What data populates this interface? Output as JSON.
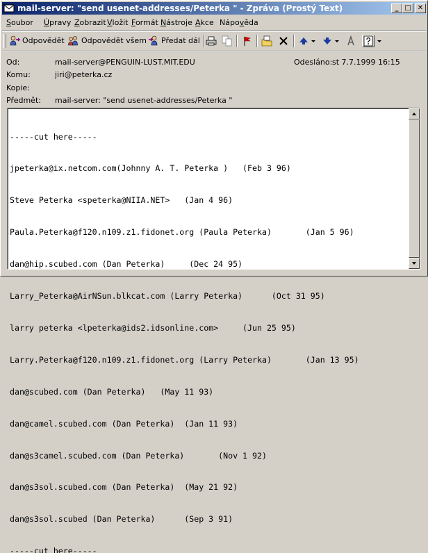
{
  "window": {
    "title": "mail-server: \"send usenet-addresses/Peterka \" - Zpráva (Prostý Text)",
    "controls": {
      "minimize": "_",
      "maximize": "□",
      "close": "✕"
    }
  },
  "menu": [
    {
      "label": "Soubor",
      "accel": "S",
      "rest": "oubor"
    },
    {
      "label": "Úpravy",
      "accel": "Ú",
      "rest": "pravy"
    },
    {
      "label": "Zobrazit",
      "accel": "Z",
      "rest": "obrazit"
    },
    {
      "label": "Vložit",
      "accel": "V",
      "rest": "ložit"
    },
    {
      "label": "Formát",
      "accel": "F",
      "rest": "ormát"
    },
    {
      "label": "Nástroje",
      "accel": "N",
      "rest": "ástroje"
    },
    {
      "label": "Akce",
      "accel": "A",
      "rest": "kce"
    },
    {
      "label": "Nápověda",
      "pre": "Nápo",
      "accel": "v",
      "rest": "ěda"
    }
  ],
  "toolbar": {
    "reply": "Odpovědět",
    "reply_all": "Odpovědět všem",
    "forward": "Předat dál",
    "icons": [
      "reply-icon",
      "reply-all-icon",
      "forward-icon",
      "print-icon",
      "copy-icon",
      "flag-icon",
      "move-to-folder-icon",
      "delete-icon",
      "previous-item-icon",
      "next-item-icon",
      "address-book-icon",
      "help-icon"
    ]
  },
  "header": {
    "from_label": "Od:",
    "from_value": "mail-server@PENGUIN-LUST.MIT.EDU",
    "sent_label": "Odesláno:",
    "sent_value": "st 7.7.1999 16:15",
    "to_label": "Komu:",
    "to_value": "jiri@peterka.cz",
    "cc_label": "Kopie:",
    "cc_value": "",
    "subject_label": "Předmět:",
    "subject_value": "mail-server: \"send usenet-addresses/Peterka \""
  },
  "body": {
    "lines": [
      "-----cut here-----",
      "jpeterka@ix.netcom.com(Johnny A. T. Peterka )   (Feb 3 96)",
      "Steve Peterka <speterka@NIIA.NET>   (Jan 4 96)",
      "Paula.Peterka@f120.n109.z1.fidonet.org (Paula Peterka)       (Jan 5 96)",
      "dan@hip.scubed.com (Dan Peterka)     (Dec 24 95)",
      "Larry_Peterka@AirNSun.blkcat.com (Larry Peterka)      (Oct 31 95)",
      "larry peterka <lpeterka@ids2.idsonline.com>     (Jun 25 95)",
      "Larry.Peterka@f120.n109.z1.fidonet.org (Larry Peterka)       (Jan 13 95)",
      "dan@scubed.com (Dan Peterka)   (May 11 93)",
      "dan@camel.scubed.com (Dan Peterka)  (Jan 11 93)",
      "dan@s3camel.scubed.com (Dan Peterka)       (Nov 1 92)",
      "dan@s3sol.scubed.com (Dan Peterka)  (May 21 92)",
      "dan@s3sol.scubed (Dan Peterka)      (Sep 3 91)",
      "-----cut here-----"
    ]
  }
}
